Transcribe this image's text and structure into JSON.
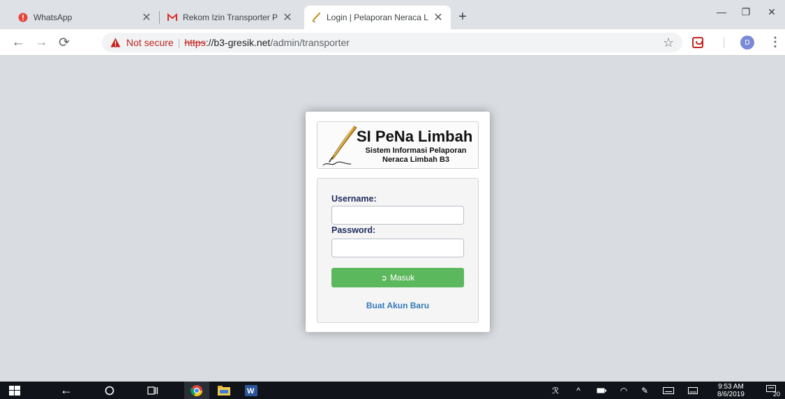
{
  "browser": {
    "tabs": [
      {
        "title": "WhatsApp",
        "favicon": "whatsapp-alert-icon"
      },
      {
        "title": "Rekom Izin Transporter PT. Sun",
        "favicon": "gmail-icon"
      },
      {
        "title": "Login | Pelaporan Neraca Limb",
        "favicon": "quill-icon"
      }
    ],
    "security_label": "Not secure",
    "url_scheme": "https",
    "url_host": "://b3-gresik.net",
    "url_path": "/admin/transporter",
    "profile_initial": "D"
  },
  "logo": {
    "title": "SI PeNa Limbah",
    "subtitle_line1": "Sistem Informasi Pelaporan",
    "subtitle_line2": "Neraca Limbah B3"
  },
  "login": {
    "username_label": "Username:",
    "username_value": "",
    "password_label": "Password:",
    "password_value": "",
    "submit_label": "Masuk",
    "create_account_label": "Buat Akun Baru"
  },
  "taskbar": {
    "time": "9:53 AM",
    "date": "8/6/2019",
    "notification_count": "20"
  },
  "colors": {
    "page_background": "#d9dde2",
    "submit_button": "#5cb85c",
    "link": "#337ab7",
    "label": "#1d2a5e",
    "warning": "#c5221f"
  }
}
